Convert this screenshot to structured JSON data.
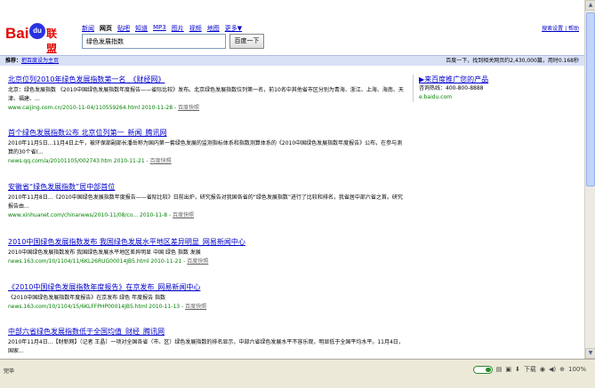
{
  "logo": {
    "bai": "Bai",
    "du": "du",
    "suffix": "联盟"
  },
  "nav": {
    "items": [
      {
        "label": "新闻",
        "current": false
      },
      {
        "label": "网页",
        "current": true
      },
      {
        "label": "贴吧",
        "current": false
      },
      {
        "label": "知道",
        "current": false
      },
      {
        "label": "MP3",
        "current": false
      },
      {
        "label": "图片",
        "current": false
      },
      {
        "label": "视频",
        "current": false
      },
      {
        "label": "地图",
        "current": false
      },
      {
        "label": "更多▼",
        "current": false
      }
    ]
  },
  "search": {
    "query": "绿色发展指数",
    "button_label": "百度一下",
    "settings_label": "搜索设置 | 帮助"
  },
  "resultbar": {
    "prefix": "推荐：",
    "link": "把百度设为主页",
    "stats": "百度一下，找到相关网页约2,430,000篇，用时0.168秒"
  },
  "results": [
    {
      "title": "北京位列2010年绿色发展指数第一名_《财经网》",
      "snippet": "北京：绿色发展指数 《2010中国绿色发展指数年度报告——省际比较》发布。北京绿色发展指数位列第一名，前10名中其他省市区分别为青海、浙江、上海、海南、天津、福建、...",
      "url": "www.caijing.com.cn/2010-11-04/110559264.html 2010-11-28 - ",
      "cache": "百度快照"
    },
    {
      "title": "首个绿色发展指数公布 北京位列第一_新闻_腾讯网",
      "snippet": "2010年11月5日...11月4日上午，被环保部副部长潘岳称为国内第一套绿色发展的监测指标体系和指数测算体系的《2010中国绿色发展指数年度报告》公布，在参与测算的30个省(...",
      "url": "news.qq.com/a/20101105/002743.htm 2010-11-21 - ",
      "cache": "百度快照"
    },
    {
      "title": "安徽省“绿色发展指数”居中部首位",
      "snippet": "2010年11月8日...《2010中国绿色发展指数年度报告——省际比较》日前出炉，研究报告对我国各省的“绿色发展指数”进行了比较和排名，我省居中部六省之首。研究报告由...",
      "url": "www.xinhuanet.com/chinanews/2010-11/08/co... 2010-11-8 - ",
      "cache": "百度快照"
    },
    {
      "title": "2010中国绿色发展指数发布 我国绿色发展水平地区差异明显_网易新闻中心",
      "snippet": "2010中国绿色发展指数发布 我国绿色发展水平地区差异明显 中国 绿色 指数 发展",
      "url": "news.163.com/10/1104/11/6KL26RUG00014JB5.html 2010-11-21 - ",
      "cache": "百度快照"
    },
    {
      "title": "《2010中国绿色发展指数年度报告》在京发布_网易新闻中心",
      "snippet": "《2010中国绿色发展指数年度报告》在京发布 绿色 年度报告 指数",
      "url": "news.163.com/10/1104/15/6KLFFPHP00014JB5.html 2010-11-13 - ",
      "cache": "百度快照"
    },
    {
      "title": "中部六省绿色发展指数低于全国均值_财经_腾讯网",
      "snippet": "2010年11月4日...【财新网】（记者 王晶）一项对全国各省（市、区）绿色发展指数的排名显示，中部六省绿色发展水平不容乐观，明显低于全国平均水平。11月4日，国家...",
      "url": "",
      "cache": ""
    }
  ],
  "ad": {
    "title": "▶来百度推广您的产品",
    "line": "咨询热线：400-800-8888",
    "url": "e.baidu.com"
  },
  "statusbar": {
    "status": "完毕",
    "download_label": "下载",
    "zoom": "100%"
  }
}
